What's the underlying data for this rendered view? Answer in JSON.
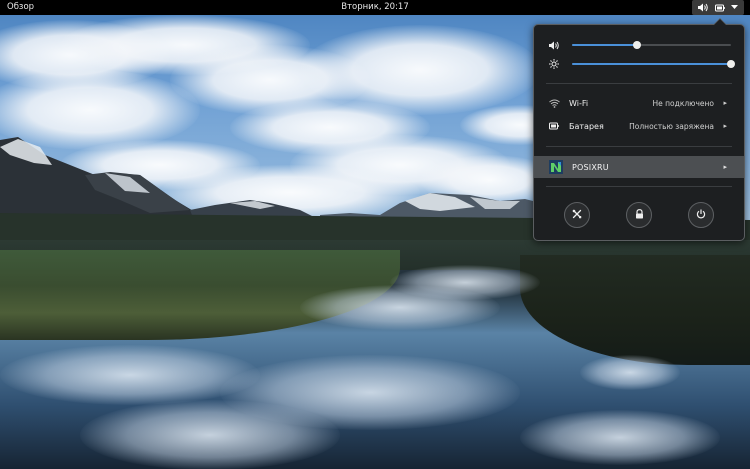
{
  "topbar": {
    "activities_label": "Обзор",
    "clock_label": "Вторник, 20:17",
    "status_icons": [
      "volume-icon",
      "battery-icon",
      "chevron-down-icon"
    ]
  },
  "menu": {
    "volume": {
      "icon": "volume-icon",
      "level": 0.41
    },
    "brightness": {
      "icon": "brightness-icon",
      "level": 1.0
    },
    "wifi": {
      "icon": "wifi-icon",
      "label": "Wi-Fi",
      "value": "Не подключено",
      "chevron": "▸"
    },
    "battery": {
      "icon": "battery-icon",
      "label": "Батарея",
      "value": "Полностью заряжена",
      "chevron": "▸"
    },
    "user": {
      "icon": "avatar",
      "name": "POSIXRU",
      "chevron": "▸"
    },
    "buttons": [
      "settings-icon",
      "lock-icon",
      "power-icon"
    ]
  },
  "colors": {
    "topbar_bg": "#000000",
    "menu_bg": "#1d1f21",
    "accent": "#4a90d9",
    "user_row_bg": "#4c4f52"
  }
}
